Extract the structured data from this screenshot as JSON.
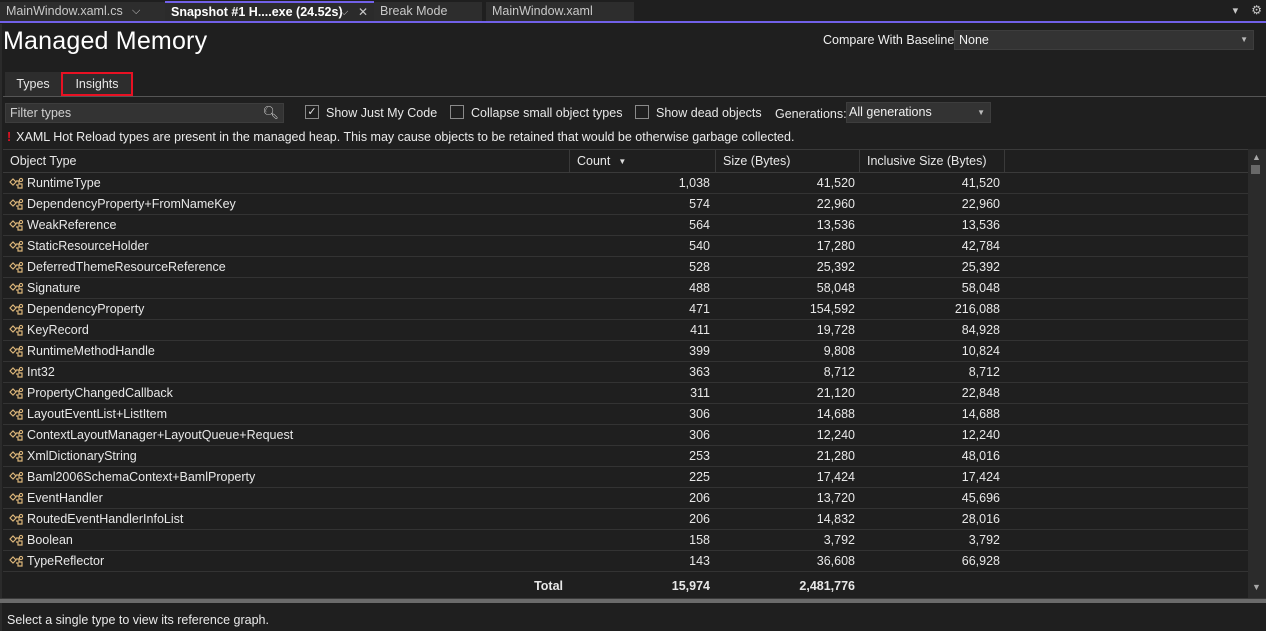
{
  "tabstrip": {
    "tabs": [
      {
        "label": "MainWindow.xaml.cs",
        "pinned": true,
        "active": false
      },
      {
        "label": "Snapshot #1 H....exe (24.52s)",
        "pinned": true,
        "closable": true,
        "active": true
      },
      {
        "label": "Break Mode",
        "active": false
      },
      {
        "label": "MainWindow.xaml",
        "active": false
      }
    ],
    "pin_icon": "⌵",
    "close_icon": "✕",
    "overflow_icon": "▾",
    "settings_icon": "⚙",
    "accent_color": "#7160e8"
  },
  "header": {
    "title": "Managed Memory",
    "baseline_label": "Compare With Baseline:",
    "baseline_value": "None"
  },
  "view_tabs": [
    {
      "label": "Types",
      "active": false
    },
    {
      "label": "Insights",
      "active": true,
      "highlighted": true
    }
  ],
  "toolbar": {
    "filter_placeholder": "Filter types",
    "checkboxes": [
      {
        "label": "Show Just My Code",
        "checked": true
      },
      {
        "label": "Collapse small object types",
        "checked": false
      },
      {
        "label": "Show dead objects",
        "checked": false
      }
    ],
    "generations_label": "Generations:",
    "generations_value": "All generations"
  },
  "warning": {
    "icon": "!",
    "text": "XAML Hot Reload types are present in the managed heap. This may cause objects to be retained that would be otherwise garbage collected."
  },
  "grid": {
    "columns": [
      "Object Type",
      "Count",
      "Size (Bytes)",
      "Inclusive Size (Bytes)"
    ],
    "sort_column": "Count",
    "sort_direction": "descending",
    "rows": [
      {
        "type": "RuntimeType",
        "count": "1,038",
        "size": "41,520",
        "inclusive": "41,520"
      },
      {
        "type": "DependencyProperty+FromNameKey",
        "count": "574",
        "size": "22,960",
        "inclusive": "22,960"
      },
      {
        "type": "WeakReference",
        "count": "564",
        "size": "13,536",
        "inclusive": "13,536"
      },
      {
        "type": "StaticResourceHolder",
        "count": "540",
        "size": "17,280",
        "inclusive": "42,784"
      },
      {
        "type": "DeferredThemeResourceReference",
        "count": "528",
        "size": "25,392",
        "inclusive": "25,392"
      },
      {
        "type": "Signature",
        "count": "488",
        "size": "58,048",
        "inclusive": "58,048"
      },
      {
        "type": "DependencyProperty",
        "count": "471",
        "size": "154,592",
        "inclusive": "216,088"
      },
      {
        "type": "KeyRecord",
        "count": "411",
        "size": "19,728",
        "inclusive": "84,928"
      },
      {
        "type": "RuntimeMethodHandle",
        "count": "399",
        "size": "9,808",
        "inclusive": "10,824"
      },
      {
        "type": "Int32",
        "count": "363",
        "size": "8,712",
        "inclusive": "8,712"
      },
      {
        "type": "PropertyChangedCallback",
        "count": "311",
        "size": "21,120",
        "inclusive": "22,848"
      },
      {
        "type": "LayoutEventList+ListItem",
        "count": "306",
        "size": "14,688",
        "inclusive": "14,688"
      },
      {
        "type": "ContextLayoutManager+LayoutQueue+Request",
        "count": "306",
        "size": "12,240",
        "inclusive": "12,240"
      },
      {
        "type": "XmlDictionaryString",
        "count": "253",
        "size": "21,280",
        "inclusive": "48,016"
      },
      {
        "type": "Baml2006SchemaContext+BamlProperty",
        "count": "225",
        "size": "17,424",
        "inclusive": "17,424"
      },
      {
        "type": "EventHandler",
        "count": "206",
        "size": "13,720",
        "inclusive": "45,696"
      },
      {
        "type": "RoutedEventHandlerInfoList",
        "count": "206",
        "size": "14,832",
        "inclusive": "28,016"
      },
      {
        "type": "Boolean",
        "count": "158",
        "size": "3,792",
        "inclusive": "3,792"
      },
      {
        "type": "TypeReflector",
        "count": "143",
        "size": "36,608",
        "inclusive": "66,928"
      }
    ],
    "total": {
      "label": "Total",
      "count": "15,974",
      "size": "2,481,776"
    }
  },
  "status": {
    "text": "Select a single type to view its reference graph."
  }
}
